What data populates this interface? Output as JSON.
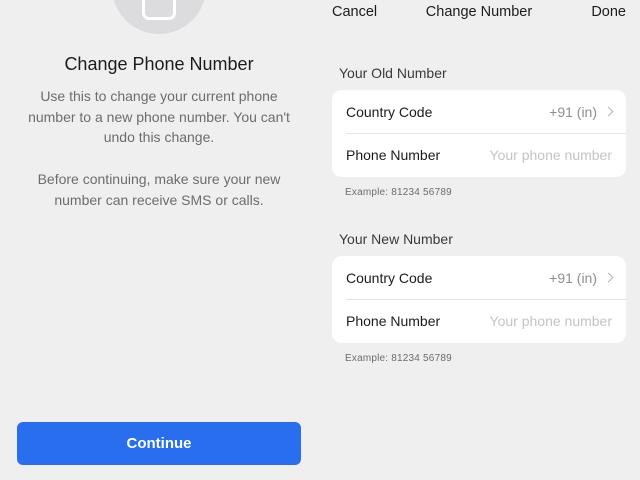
{
  "left": {
    "title": "Change Phone Number",
    "description": "Use this to change your current phone number to a new phone number. You can't undo this change.",
    "description2": "Before continuing, make sure your new number can receive SMS or calls.",
    "continue_label": "Continue"
  },
  "nav": {
    "cancel": "Cancel",
    "title": "Change Number",
    "done": "Done"
  },
  "old_number": {
    "header": "Your Old Number",
    "country_label": "Country Code",
    "country_value": "+91 (in)",
    "phone_label": "Phone Number",
    "phone_placeholder": "Your phone number",
    "example": "Example:  81234 56789"
  },
  "new_number": {
    "header": "Your New Number",
    "country_label": "Country Code",
    "country_value": "+91 (in)",
    "phone_label": "Phone Number",
    "phone_placeholder": "Your phone number",
    "example": "Example:  81234 56789"
  },
  "colors": {
    "accent": "#2a6ef0",
    "background": "#efeff0",
    "card": "#ffffff"
  },
  "icons": [
    "phone-icon",
    "chevron-right-icon"
  ]
}
